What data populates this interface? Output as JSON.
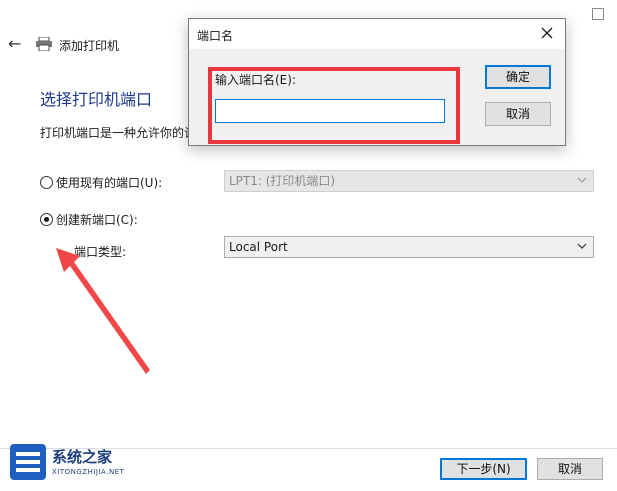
{
  "wizard": {
    "title": "添加打印机",
    "heading": "选择打印机端口",
    "description": "打印机端口是一种允许你的计",
    "options": {
      "existing_label": "使用现有的端口(U):",
      "existing_value": "LPT1: (打印机端口)",
      "new_label": "创建新端口(C):",
      "type_label": "端口类型:",
      "type_value": "Local Port"
    },
    "buttons": {
      "next": "下一步(N)",
      "cancel": "取消"
    }
  },
  "dialog": {
    "title": "端口名",
    "field_label": "输入端口名(E):",
    "field_value": "",
    "ok": "确定",
    "cancel": "取消"
  },
  "watermark": {
    "name": "系统之家",
    "domain": "XITONGZHIJIA.NET"
  },
  "colors": {
    "accent": "#0078d7",
    "highlight": "#e8383d",
    "heading": "#1e3a8a"
  }
}
